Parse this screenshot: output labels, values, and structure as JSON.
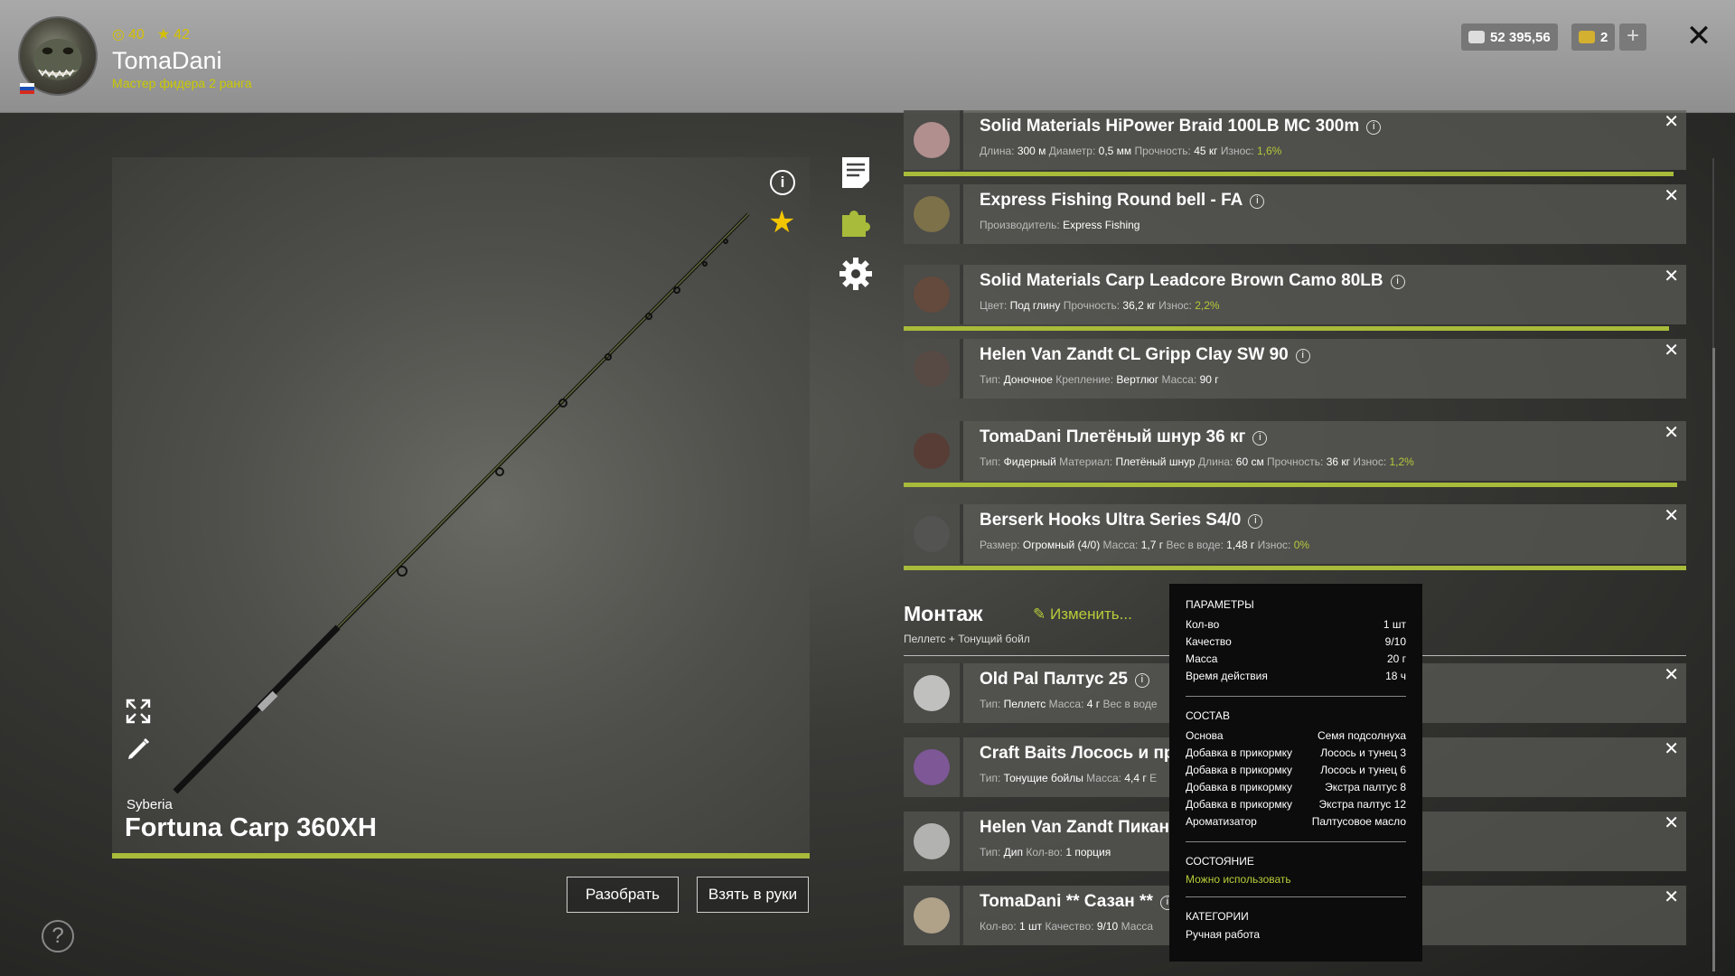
{
  "player": {
    "level_a": "40",
    "level_b": "42",
    "name": "TomaDani",
    "rank": "Мастер фидера 2 ранга"
  },
  "wallet": {
    "silver": "52 395,56",
    "gold": "2"
  },
  "rod": {
    "brand": "Syberia",
    "name": "Fortuna Carp 360XH",
    "disassemble_label": "Разобрать",
    "take_label": "Взять в руки"
  },
  "components": [
    {
      "title": "Solid Materials HiPower Braid 100LB MC 300m",
      "meta": [
        [
          "Длина:",
          "300 м"
        ],
        [
          "Диаметр:",
          "0,5 мм"
        ],
        [
          "Прочность:",
          "45 кг"
        ],
        [
          "Износ:",
          "1,6%"
        ]
      ],
      "wear_pct": 98.4
    },
    {
      "title": "Express Fishing Round bell - FA",
      "meta": [
        [
          "Производитель:",
          "Express Fishing"
        ]
      ]
    },
    {
      "title": "Solid Materials Carp Leadcore Brown Camo 80LB",
      "meta": [
        [
          "Цвет:",
          "Под глину"
        ],
        [
          "Прочность:",
          "36,2 кг"
        ],
        [
          "Износ:",
          "2,2%"
        ]
      ],
      "wear_pct": 97.8
    },
    {
      "title": "Helen Van Zandt CL Gripp Clay SW 90",
      "meta": [
        [
          "Тип:",
          "Доночное"
        ],
        [
          "Крепление:",
          "Вертлюг"
        ],
        [
          "Масса:",
          "90 г"
        ]
      ]
    },
    {
      "title": "TomaDani Плетёный шнур 36 кг",
      "meta": [
        [
          "Тип:",
          "Фидерный"
        ],
        [
          "Материал:",
          "Плетёный шнур"
        ],
        [
          "Длина:",
          "60 см"
        ],
        [
          "Прочность:",
          "36 кг"
        ],
        [
          "Износ:",
          "1,2%"
        ]
      ],
      "wear_pct": 98.8
    },
    {
      "title": "Berserk Hooks Ultra Series S4/0",
      "meta": [
        [
          "Размер:",
          "Огромный (4/0)"
        ],
        [
          "Масса:",
          "1,7 г"
        ],
        [
          "Вес в воде:",
          "1,48 г"
        ],
        [
          "Износ:",
          "0%"
        ]
      ],
      "wear_pct": 100
    }
  ],
  "montage": {
    "title": "Монтаж",
    "edit_label": "Изменить...",
    "subtitle": "Пеллетс  +  Тонущий бойл",
    "items": [
      {
        "title": "Old Pal Палтус 25",
        "meta": [
          [
            "Тип:",
            "Пеллетс"
          ],
          [
            "Масса:",
            "4 г"
          ],
          [
            "Вес в воде",
            ""
          ]
        ]
      },
      {
        "title": "Craft Baits Лосось и пря",
        "meta": [
          [
            "Тип:",
            "Тонущие бойлы"
          ],
          [
            "Масса:",
            "4,4 г"
          ],
          [
            "E",
            ""
          ]
        ]
      },
      {
        "title": "Helen Van Zandt Пикант",
        "meta": [
          [
            "Тип:",
            "Дип"
          ],
          [
            "Кол-во:",
            "1 порция"
          ]
        ]
      },
      {
        "title": "TomaDani ** Сазан **",
        "meta": [
          [
            "Кол-во:",
            "1 шт"
          ],
          [
            "Качество:",
            "9/10"
          ],
          [
            "Масса",
            ""
          ]
        ]
      }
    ]
  },
  "tooltip": {
    "params_title": "ПАРАМЕТРЫ",
    "params": [
      [
        "Кол-во",
        "1 шт"
      ],
      [
        "Качество",
        "9/10"
      ],
      [
        "Масса",
        "20 г"
      ],
      [
        "Время действия",
        "18 ч"
      ]
    ],
    "composition_title": "СОСТАВ",
    "composition": [
      [
        "Основа",
        "Семя подсолнуха"
      ],
      [
        "Добавка в прикормку",
        "Лосось и тунец 3"
      ],
      [
        "Добавка в прикормку",
        "Лосось и тунец 6"
      ],
      [
        "Добавка в прикормку",
        "Экстра палтус 8"
      ],
      [
        "Добавка в прикормку",
        "Экстра палтус 12"
      ],
      [
        "Ароматизатор",
        "Палтусовое масло"
      ]
    ],
    "state_title": "СОСТОЯНИЕ",
    "state": "Можно использовать",
    "categories_title": "КАТЕГОРИИ",
    "category": "Ручная работа"
  },
  "colors": {
    "accent": "#a8bb3a",
    "header": "#9c9c9c"
  },
  "icons": [
    "settings-icon",
    "info-icon",
    "star-icon",
    "notes-icon",
    "puzzle-icon",
    "expand-icon",
    "brush-icon",
    "help-icon",
    "close-icon",
    "edit-icon"
  ]
}
